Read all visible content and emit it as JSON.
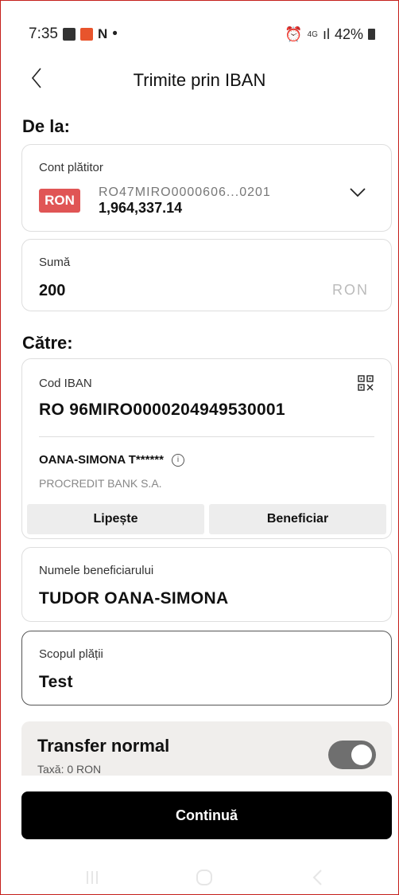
{
  "status_bar": {
    "time": "7:35",
    "network": "4G",
    "battery": "42%"
  },
  "header": {
    "title": "Trimite prin IBAN"
  },
  "from": {
    "section_label": "De la:",
    "account_caption": "Cont plătitor",
    "currency_badge": "RON",
    "iban": "RO47MIRO0000606...0201",
    "balance": "1,964,337.14"
  },
  "amount": {
    "caption": "Sumă",
    "value": "200",
    "currency": "RON"
  },
  "to": {
    "section_label": "Către:",
    "iban_caption": "Cod IBAN",
    "iban": "RO 96MIRO0000204949530001",
    "holder": "OANA-SIMONA T******",
    "bank": "PROCREDIT BANK S.A.",
    "paste_label": "Lipește",
    "beneficiary_label": "Beneficiar"
  },
  "beneficiary_name": {
    "caption": "Numele beneficiarului",
    "value": "TUDOR OANA-SIMONA"
  },
  "purpose": {
    "caption": "Scopul plății",
    "value": "Test"
  },
  "transfer": {
    "title": "Transfer normal",
    "fee": "Taxă: 0 RON",
    "enabled": true
  },
  "continue_label": "Continuă",
  "colors": {
    "badge": "#e05555",
    "border": "#c5201c",
    "button": "#000000"
  }
}
